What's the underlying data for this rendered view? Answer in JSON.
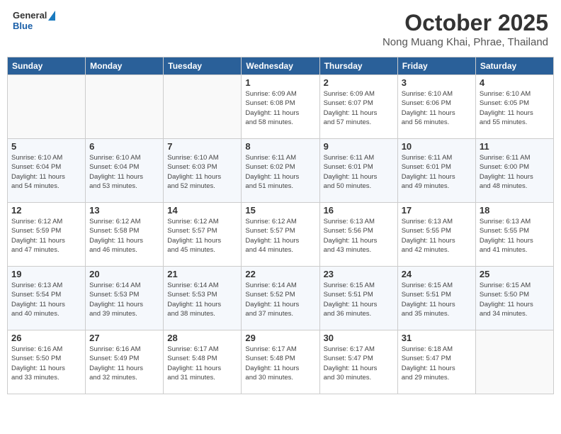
{
  "header": {
    "logo_general": "General",
    "logo_blue": "Blue",
    "month": "October 2025",
    "location": "Nong Muang Khai, Phrae, Thailand"
  },
  "weekdays": [
    "Sunday",
    "Monday",
    "Tuesday",
    "Wednesday",
    "Thursday",
    "Friday",
    "Saturday"
  ],
  "weeks": [
    [
      {
        "day": "",
        "info": ""
      },
      {
        "day": "",
        "info": ""
      },
      {
        "day": "",
        "info": ""
      },
      {
        "day": "1",
        "info": "Sunrise: 6:09 AM\nSunset: 6:08 PM\nDaylight: 11 hours\nand 58 minutes."
      },
      {
        "day": "2",
        "info": "Sunrise: 6:09 AM\nSunset: 6:07 PM\nDaylight: 11 hours\nand 57 minutes."
      },
      {
        "day": "3",
        "info": "Sunrise: 6:10 AM\nSunset: 6:06 PM\nDaylight: 11 hours\nand 56 minutes."
      },
      {
        "day": "4",
        "info": "Sunrise: 6:10 AM\nSunset: 6:05 PM\nDaylight: 11 hours\nand 55 minutes."
      }
    ],
    [
      {
        "day": "5",
        "info": "Sunrise: 6:10 AM\nSunset: 6:04 PM\nDaylight: 11 hours\nand 54 minutes."
      },
      {
        "day": "6",
        "info": "Sunrise: 6:10 AM\nSunset: 6:04 PM\nDaylight: 11 hours\nand 53 minutes."
      },
      {
        "day": "7",
        "info": "Sunrise: 6:10 AM\nSunset: 6:03 PM\nDaylight: 11 hours\nand 52 minutes."
      },
      {
        "day": "8",
        "info": "Sunrise: 6:11 AM\nSunset: 6:02 PM\nDaylight: 11 hours\nand 51 minutes."
      },
      {
        "day": "9",
        "info": "Sunrise: 6:11 AM\nSunset: 6:01 PM\nDaylight: 11 hours\nand 50 minutes."
      },
      {
        "day": "10",
        "info": "Sunrise: 6:11 AM\nSunset: 6:01 PM\nDaylight: 11 hours\nand 49 minutes."
      },
      {
        "day": "11",
        "info": "Sunrise: 6:11 AM\nSunset: 6:00 PM\nDaylight: 11 hours\nand 48 minutes."
      }
    ],
    [
      {
        "day": "12",
        "info": "Sunrise: 6:12 AM\nSunset: 5:59 PM\nDaylight: 11 hours\nand 47 minutes."
      },
      {
        "day": "13",
        "info": "Sunrise: 6:12 AM\nSunset: 5:58 PM\nDaylight: 11 hours\nand 46 minutes."
      },
      {
        "day": "14",
        "info": "Sunrise: 6:12 AM\nSunset: 5:57 PM\nDaylight: 11 hours\nand 45 minutes."
      },
      {
        "day": "15",
        "info": "Sunrise: 6:12 AM\nSunset: 5:57 PM\nDaylight: 11 hours\nand 44 minutes."
      },
      {
        "day": "16",
        "info": "Sunrise: 6:13 AM\nSunset: 5:56 PM\nDaylight: 11 hours\nand 43 minutes."
      },
      {
        "day": "17",
        "info": "Sunrise: 6:13 AM\nSunset: 5:55 PM\nDaylight: 11 hours\nand 42 minutes."
      },
      {
        "day": "18",
        "info": "Sunrise: 6:13 AM\nSunset: 5:55 PM\nDaylight: 11 hours\nand 41 minutes."
      }
    ],
    [
      {
        "day": "19",
        "info": "Sunrise: 6:13 AM\nSunset: 5:54 PM\nDaylight: 11 hours\nand 40 minutes."
      },
      {
        "day": "20",
        "info": "Sunrise: 6:14 AM\nSunset: 5:53 PM\nDaylight: 11 hours\nand 39 minutes."
      },
      {
        "day": "21",
        "info": "Sunrise: 6:14 AM\nSunset: 5:53 PM\nDaylight: 11 hours\nand 38 minutes."
      },
      {
        "day": "22",
        "info": "Sunrise: 6:14 AM\nSunset: 5:52 PM\nDaylight: 11 hours\nand 37 minutes."
      },
      {
        "day": "23",
        "info": "Sunrise: 6:15 AM\nSunset: 5:51 PM\nDaylight: 11 hours\nand 36 minutes."
      },
      {
        "day": "24",
        "info": "Sunrise: 6:15 AM\nSunset: 5:51 PM\nDaylight: 11 hours\nand 35 minutes."
      },
      {
        "day": "25",
        "info": "Sunrise: 6:15 AM\nSunset: 5:50 PM\nDaylight: 11 hours\nand 34 minutes."
      }
    ],
    [
      {
        "day": "26",
        "info": "Sunrise: 6:16 AM\nSunset: 5:50 PM\nDaylight: 11 hours\nand 33 minutes."
      },
      {
        "day": "27",
        "info": "Sunrise: 6:16 AM\nSunset: 5:49 PM\nDaylight: 11 hours\nand 32 minutes."
      },
      {
        "day": "28",
        "info": "Sunrise: 6:17 AM\nSunset: 5:48 PM\nDaylight: 11 hours\nand 31 minutes."
      },
      {
        "day": "29",
        "info": "Sunrise: 6:17 AM\nSunset: 5:48 PM\nDaylight: 11 hours\nand 30 minutes."
      },
      {
        "day": "30",
        "info": "Sunrise: 6:17 AM\nSunset: 5:47 PM\nDaylight: 11 hours\nand 30 minutes."
      },
      {
        "day": "31",
        "info": "Sunrise: 6:18 AM\nSunset: 5:47 PM\nDaylight: 11 hours\nand 29 minutes."
      },
      {
        "day": "",
        "info": ""
      }
    ]
  ]
}
